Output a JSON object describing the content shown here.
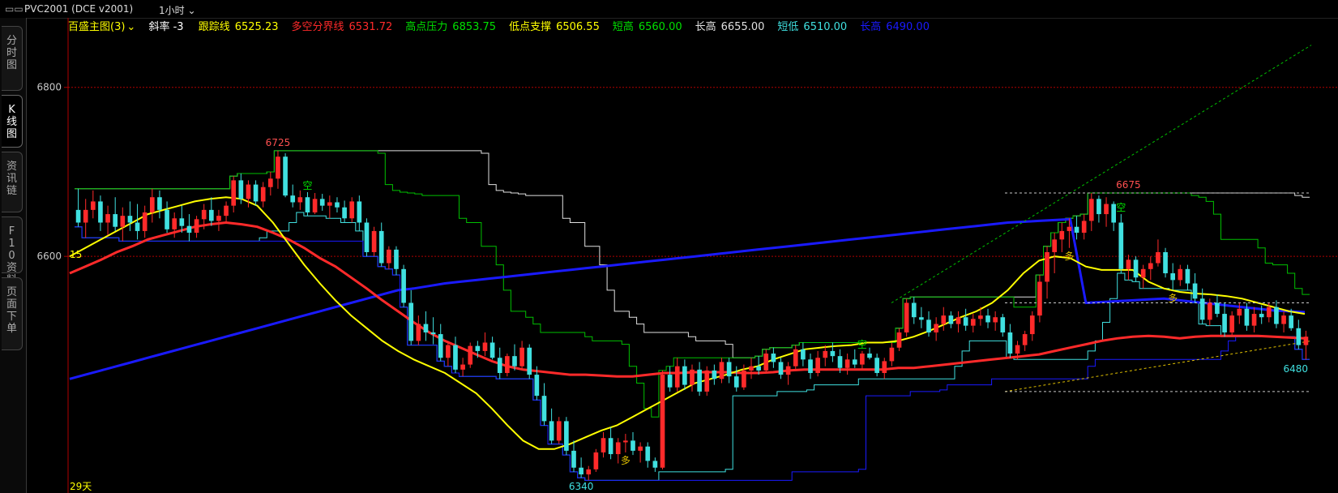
{
  "title_bar": {
    "window_icon": "window-restore-icon",
    "symbol": "PVC2001 (DCE v2001)",
    "period": "1小时"
  },
  "side_tabs": [
    {
      "label": "分时图",
      "active": false
    },
    {
      "label": "K线图",
      "active": true
    },
    {
      "label": "资讯链",
      "active": false
    },
    {
      "label": "F10资料",
      "active": false
    },
    {
      "label": "页面下单",
      "active": false
    }
  ],
  "indicator_bar": {
    "name": "百盛主图(3)",
    "slope": "斜率 -3",
    "items": [
      {
        "label": "跟踪线",
        "value": "6525.23",
        "color": "#ffff00"
      },
      {
        "label": "多空分界线",
        "value": "6531.72",
        "color": "#ff2a2a"
      },
      {
        "label": "高点压力",
        "value": "6853.75",
        "color": "#00e000"
      },
      {
        "label": "低点支撑",
        "value": "6506.55",
        "color": "#ffff00"
      },
      {
        "label": "短高",
        "value": "6560.00",
        "color": "#00e000"
      },
      {
        "label": "长高",
        "value": "6655.00",
        "color": "#e0e0e0"
      },
      {
        "label": "短低",
        "value": "6510.00",
        "color": "#40e0e0"
      },
      {
        "label": "长高",
        "value": "6490.00",
        "color": "#1a1aff"
      }
    ]
  },
  "chart_data": {
    "type": "candlestick",
    "ylim": [
      6320,
      6865
    ],
    "y_ticks": [
      6600,
      6800
    ],
    "annotations": {
      "high_1": "6725",
      "high_2": "6675",
      "low": "6340",
      "last": "6480",
      "days": "29天",
      "left_mark": "15"
    },
    "signals": [
      {
        "text": "空",
        "type": "sell"
      },
      {
        "text": "多",
        "type": "buy"
      }
    ],
    "colors": {
      "up": "#ff2a2a",
      "down": "#40e0e0",
      "flat": "#c8c8c8",
      "tracking": "#ffff00",
      "divider": "#ff2a2a",
      "ma_long": "#1a1aff",
      "short_high": "#00c000",
      "long_high": "#e0e0e0",
      "short_low": "#40e0e0",
      "long_low": "#1a1aff"
    },
    "candles": [
      [
        6655,
        6680,
        6635,
        6640
      ],
      [
        6640,
        6668,
        6622,
        6655
      ],
      [
        6655,
        6678,
        6645,
        6665
      ],
      [
        6665,
        6672,
        6630,
        6640
      ],
      [
        6640,
        6660,
        6625,
        6650
      ],
      [
        6650,
        6670,
        6630,
        6635
      ],
      [
        6635,
        6658,
        6618,
        6648
      ],
      [
        6648,
        6665,
        6630,
        6640
      ],
      [
        6640,
        6662,
        6620,
        6630
      ],
      [
        6630,
        6660,
        6622,
        6652
      ],
      [
        6652,
        6680,
        6640,
        6670
      ],
      [
        6670,
        6678,
        6645,
        6655
      ],
      [
        6655,
        6665,
        6628,
        6632
      ],
      [
        6632,
        6652,
        6622,
        6645
      ],
      [
        6645,
        6660,
        6628,
        6636
      ],
      [
        6636,
        6650,
        6618,
        6628
      ],
      [
        6628,
        6648,
        6622,
        6644
      ],
      [
        6644,
        6662,
        6632,
        6655
      ],
      [
        6655,
        6670,
        6636,
        6642
      ],
      [
        6642,
        6655,
        6630,
        6648
      ],
      [
        6648,
        6665,
        6640,
        6660
      ],
      [
        6660,
        6695,
        6652,
        6690
      ],
      [
        6690,
        6698,
        6662,
        6668
      ],
      [
        6668,
        6690,
        6658,
        6685
      ],
      [
        6685,
        6690,
        6660,
        6665
      ],
      [
        6665,
        6688,
        6658,
        6682
      ],
      [
        6682,
        6700,
        6672,
        6692
      ],
      [
        6692,
        6725,
        6680,
        6718
      ],
      [
        6718,
        6722,
        6670,
        6672
      ],
      [
        6672,
        6685,
        6658,
        6664
      ],
      [
        6664,
        6678,
        6655,
        6670
      ],
      [
        6670,
        6676,
        6648,
        6652
      ],
      [
        6652,
        6675,
        6650,
        6668
      ],
      [
        6668,
        6674,
        6654,
        6660
      ],
      [
        6660,
        6672,
        6645,
        6664
      ],
      [
        6664,
        6670,
        6652,
        6658
      ],
      [
        6658,
        6666,
        6640,
        6645
      ],
      [
        6645,
        6670,
        6640,
        6665
      ],
      [
        6665,
        6672,
        6630,
        6640
      ],
      [
        6640,
        6645,
        6600,
        6605
      ],
      [
        6605,
        6635,
        6600,
        6630
      ],
      [
        6630,
        6640,
        6588,
        6592
      ],
      [
        6592,
        6612,
        6585,
        6608
      ],
      [
        6608,
        6612,
        6578,
        6585
      ],
      [
        6585,
        6590,
        6540,
        6545
      ],
      [
        6545,
        6560,
        6495,
        6500
      ],
      [
        6500,
        6530,
        6495,
        6520
      ],
      [
        6520,
        6535,
        6500,
        6510
      ],
      [
        6510,
        6528,
        6496,
        6508
      ],
      [
        6508,
        6520,
        6476,
        6480
      ],
      [
        6480,
        6500,
        6470,
        6495
      ],
      [
        6495,
        6505,
        6462,
        6466
      ],
      [
        6466,
        6480,
        6458,
        6472
      ],
      [
        6472,
        6498,
        6468,
        6494
      ],
      [
        6494,
        6500,
        6480,
        6488
      ],
      [
        6488,
        6510,
        6482,
        6498
      ],
      [
        6498,
        6505,
        6478,
        6480
      ],
      [
        6480,
        6492,
        6455,
        6462
      ],
      [
        6462,
        6485,
        6458,
        6482
      ],
      [
        6482,
        6496,
        6465,
        6470
      ],
      [
        6470,
        6500,
        6466,
        6492
      ],
      [
        6492,
        6496,
        6455,
        6460
      ],
      [
        6460,
        6470,
        6430,
        6435
      ],
      [
        6435,
        6450,
        6400,
        6405
      ],
      [
        6405,
        6420,
        6378,
        6382
      ],
      [
        6382,
        6410,
        6378,
        6405
      ],
      [
        6405,
        6410,
        6365,
        6370
      ],
      [
        6370,
        6382,
        6345,
        6350
      ],
      [
        6350,
        6362,
        6338,
        6342
      ],
      [
        6342,
        6352,
        6335,
        6348
      ],
      [
        6348,
        6372,
        6345,
        6368
      ],
      [
        6368,
        6392,
        6362,
        6385
      ],
      [
        6385,
        6398,
        6360,
        6366
      ],
      [
        6366,
        6385,
        6355,
        6380
      ],
      [
        6380,
        6390,
        6368,
        6382
      ],
      [
        6382,
        6392,
        6365,
        6370
      ],
      [
        6370,
        6380,
        6356,
        6375
      ],
      [
        6375,
        6380,
        6350,
        6358
      ],
      [
        6358,
        6362,
        6345,
        6350
      ],
      [
        6350,
        6465,
        6348,
        6460
      ],
      [
        6460,
        6470,
        6440,
        6445
      ],
      [
        6445,
        6480,
        6440,
        6470
      ],
      [
        6470,
        6478,
        6442,
        6448
      ],
      [
        6448,
        6472,
        6440,
        6466
      ],
      [
        6466,
        6475,
        6435,
        6440
      ],
      [
        6440,
        6470,
        6435,
        6465
      ],
      [
        6465,
        6472,
        6448,
        6455
      ],
      [
        6455,
        6480,
        6450,
        6475
      ],
      [
        6475,
        6480,
        6450,
        6458
      ],
      [
        6458,
        6470,
        6440,
        6445
      ],
      [
        6445,
        6472,
        6442,
        6465
      ],
      [
        6465,
        6480,
        6455,
        6470
      ],
      [
        6470,
        6482,
        6460,
        6465
      ],
      [
        6465,
        6490,
        6462,
        6485
      ],
      [
        6485,
        6492,
        6468,
        6475
      ],
      [
        6475,
        6480,
        6455,
        6460
      ],
      [
        6460,
        6475,
        6448,
        6470
      ],
      [
        6470,
        6495,
        6465,
        6490
      ],
      [
        6490,
        6498,
        6470,
        6478
      ],
      [
        6478,
        6485,
        6455,
        6462
      ],
      [
        6462,
        6488,
        6458,
        6480
      ],
      [
        6480,
        6495,
        6470,
        6488
      ],
      [
        6488,
        6498,
        6475,
        6482
      ],
      [
        6482,
        6490,
        6462,
        6468
      ],
      [
        6468,
        6485,
        6460,
        6478
      ],
      [
        6478,
        6490,
        6468,
        6472
      ],
      [
        6472,
        6488,
        6465,
        6485
      ],
      [
        6485,
        6492,
        6478,
        6480
      ],
      [
        6480,
        6485,
        6458,
        6462
      ],
      [
        6462,
        6480,
        6455,
        6476
      ],
      [
        6476,
        6498,
        6470,
        6492
      ],
      [
        6492,
        6515,
        6488,
        6510
      ],
      [
        6510,
        6550,
        6505,
        6545
      ],
      [
        6545,
        6552,
        6520,
        6528
      ],
      [
        6528,
        6540,
        6515,
        6525
      ],
      [
        6525,
        6535,
        6505,
        6510
      ],
      [
        6510,
        6528,
        6500,
        6520
      ],
      [
        6520,
        6540,
        6512,
        6530
      ],
      [
        6530,
        6535,
        6515,
        6520
      ],
      [
        6520,
        6535,
        6510,
        6528
      ],
      [
        6528,
        6538,
        6512,
        6518
      ],
      [
        6518,
        6532,
        6510,
        6526
      ],
      [
        6526,
        6540,
        6518,
        6530
      ],
      [
        6530,
        6538,
        6515,
        6522
      ],
      [
        6522,
        6535,
        6512,
        6528
      ],
      [
        6528,
        6532,
        6505,
        6510
      ],
      [
        6510,
        6520,
        6480,
        6485
      ],
      [
        6485,
        6500,
        6478,
        6495
      ],
      [
        6495,
        6512,
        6488,
        6508
      ],
      [
        6508,
        6535,
        6500,
        6530
      ],
      [
        6530,
        6578,
        6522,
        6570
      ],
      [
        6570,
        6612,
        6550,
        6605
      ],
      [
        6605,
        6628,
        6580,
        6620
      ],
      [
        6620,
        6640,
        6605,
        6630
      ],
      [
        6630,
        6645,
        6610,
        6635
      ],
      [
        6635,
        6648,
        6620,
        6628
      ],
      [
        6628,
        6650,
        6620,
        6642
      ],
      [
        6642,
        6675,
        6630,
        6668
      ],
      [
        6668,
        6672,
        6640,
        6650
      ],
      [
        6650,
        6670,
        6635,
        6662
      ],
      [
        6662,
        6665,
        6630,
        6640
      ],
      [
        6640,
        6650,
        6580,
        6585
      ],
      [
        6585,
        6602,
        6572,
        6596
      ],
      [
        6596,
        6600,
        6570,
        6575
      ],
      [
        6575,
        6590,
        6562,
        6585
      ],
      [
        6585,
        6600,
        6572,
        6592
      ],
      [
        6592,
        6620,
        6588,
        6605
      ],
      [
        6605,
        6610,
        6575,
        6580
      ],
      [
        6580,
        6592,
        6560,
        6572
      ],
      [
        6572,
        6590,
        6565,
        6585
      ],
      [
        6585,
        6590,
        6560,
        6568
      ],
      [
        6568,
        6580,
        6545,
        6550
      ],
      [
        6550,
        6562,
        6520,
        6525
      ],
      [
        6525,
        6550,
        6518,
        6545
      ],
      [
        6545,
        6555,
        6528,
        6532
      ],
      [
        6532,
        6545,
        6505,
        6510
      ],
      [
        6510,
        6535,
        6505,
        6530
      ],
      [
        6530,
        6545,
        6520,
        6538
      ],
      [
        6538,
        6545,
        6512,
        6518
      ],
      [
        6518,
        6540,
        6510,
        6532
      ],
      [
        6532,
        6542,
        6520,
        6528
      ],
      [
        6528,
        6545,
        6522,
        6540
      ],
      [
        6540,
        6548,
        6515,
        6520
      ],
      [
        6520,
        6535,
        6510,
        6530
      ],
      [
        6530,
        6538,
        6512,
        6515
      ],
      [
        6515,
        6525,
        6490,
        6495
      ],
      [
        6495,
        6512,
        6478,
        6505
      ]
    ],
    "lines": {
      "tracking": [
        6600,
        6610,
        6620,
        6630,
        6640,
        6650,
        6655,
        6660,
        6665,
        6668,
        6670,
        6668,
        6660,
        6640,
        6615,
        6590,
        6568,
        6548,
        6530,
        6515,
        6500,
        6488,
        6478,
        6470,
        6462,
        6450,
        6438,
        6420,
        6400,
        6382,
        6372,
        6372,
        6378,
        6386,
        6394,
        6400,
        6410,
        6420,
        6430,
        6440,
        6450,
        6455,
        6460,
        6466,
        6470,
        6478,
        6484,
        6490,
        6492,
        6494,
        6495,
        6498,
        6498,
        6500,
        6505,
        6512,
        6520,
        6528,
        6535,
        6545,
        6560,
        6580,
        6595,
        6600,
        6598,
        6588,
        6584,
        6584,
        6584,
        6570,
        6562,
        6558,
        6556,
        6555,
        6553,
        6550,
        6545,
        6540,
        6535,
        6532
      ],
      "divider": [
        6580,
        6588,
        6596,
        6605,
        6612,
        6620,
        6625,
        6630,
        6635,
        6638,
        6640,
        6638,
        6635,
        6628,
        6620,
        6610,
        6598,
        6588,
        6575,
        6562,
        6548,
        6535,
        6522,
        6510,
        6500,
        6492,
        6484,
        6476,
        6470,
        6466,
        6464,
        6462,
        6460,
        6460,
        6459,
        6458,
        6458,
        6460,
        6462,
        6462,
        6463,
        6463,
        6463,
        6462,
        6462,
        6463,
        6465,
        6466,
        6466,
        6466,
        6466,
        6466,
        6466,
        6468,
        6468,
        6470,
        6472,
        6474,
        6476,
        6478,
        6480,
        6482,
        6484,
        6488,
        6492,
        6496,
        6500,
        6503,
        6505,
        6506,
        6505,
        6503,
        6505,
        6506,
        6506,
        6506,
        6506,
        6505,
        6504,
        6503
      ],
      "ma_long": [
        6455,
        6460,
        6465,
        6470,
        6475,
        6480,
        6485,
        6490,
        6495,
        6500,
        6505,
        6510,
        6515,
        6520,
        6525,
        6530,
        6535,
        6540,
        6545,
        6550,
        6555,
        6560,
        6562,
        6565,
        6568,
        6570,
        6572,
        6574,
        6576,
        6578,
        6580,
        6582,
        6584,
        6586,
        6588,
        6590,
        6592,
        6594,
        6596,
        6598,
        6600,
        6602,
        6604,
        6606,
        6608,
        6610,
        6612,
        6614,
        6616,
        6618,
        6620,
        6622,
        6624,
        6626,
        6628,
        6630,
        6632,
        6634,
        6636,
        6638,
        6640,
        6641,
        6642,
        6643,
        6644,
        6545,
        6546,
        6547,
        6548,
        6549,
        6550,
        6548,
        6546,
        6544,
        6542,
        6540,
        6538,
        6536,
        6535,
        6534
      ]
    }
  }
}
